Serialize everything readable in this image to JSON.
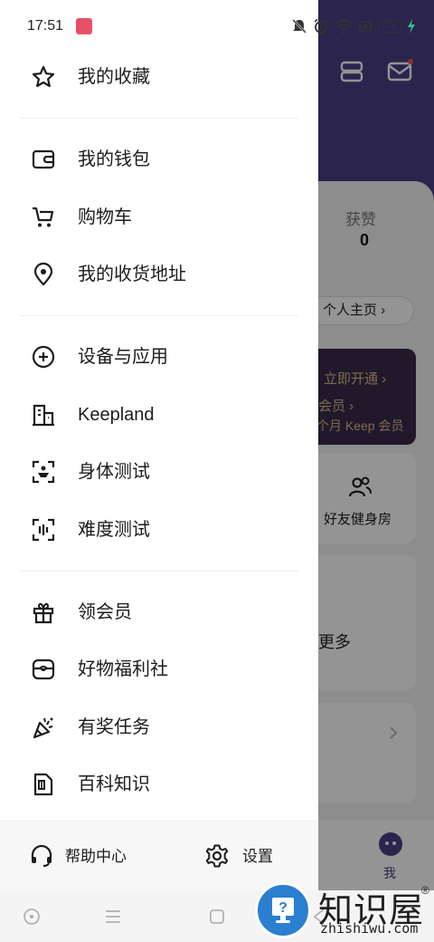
{
  "status_bar": {
    "time": "17:51",
    "battery": "13",
    "icons": [
      "bell-off-icon",
      "alarm-icon",
      "wifi-icon",
      "sim-icon",
      "battery-icon",
      "charging-icon"
    ]
  },
  "drawer": {
    "sections": [
      {
        "items": [
          {
            "label": "我的收藏",
            "icon": "star-icon"
          }
        ]
      },
      {
        "items": [
          {
            "label": "我的钱包",
            "icon": "wallet-icon"
          },
          {
            "label": "购物车",
            "icon": "cart-icon"
          },
          {
            "label": "我的收货地址",
            "icon": "location-pin-icon"
          }
        ]
      },
      {
        "items": [
          {
            "label": "设备与应用",
            "icon": "plus-circle-icon"
          },
          {
            "label": "Keepland",
            "icon": "building-icon"
          },
          {
            "label": "身体测试",
            "icon": "body-scan-icon"
          },
          {
            "label": "难度测试",
            "icon": "difficulty-scan-icon"
          }
        ]
      },
      {
        "items": [
          {
            "label": "领会员",
            "icon": "gift-icon"
          },
          {
            "label": "好物福利社",
            "icon": "product-box-icon"
          },
          {
            "label": "有奖任务",
            "icon": "party-popper-icon"
          },
          {
            "label": "百科知识",
            "icon": "encyclopedia-icon"
          }
        ]
      }
    ],
    "footer": {
      "help_label": "帮助中心",
      "settings_label": "设置"
    }
  },
  "background": {
    "likes_label": "获赞",
    "likes_value": "0",
    "profile_button": "个人主页 ›",
    "vip_open": "立即开通 ›",
    "vip_title": "会员 ›",
    "vip_subtitle": "个月 Keep 会员",
    "gym_label": "好友健身房",
    "more_label": "更多",
    "me_tab": "我"
  },
  "watermark": {
    "title": "知识屋",
    "domain": "zhishiwu.com",
    "registered": "®"
  },
  "colors": {
    "header_purple": "#4a3f86",
    "vip_gold": "#d8b98c",
    "watermark_blue": "#2a7fd0"
  }
}
